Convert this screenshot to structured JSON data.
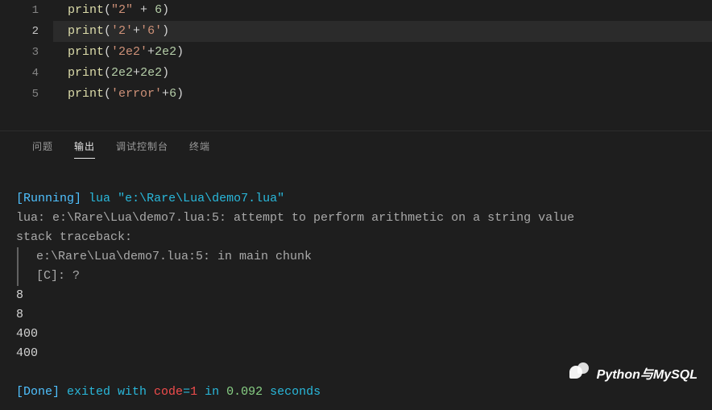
{
  "editor": {
    "active_line": 2,
    "lines": [
      {
        "num": "1",
        "tokens": [
          {
            "cls": "fn",
            "t": "print"
          },
          {
            "cls": "pun",
            "t": "("
          },
          {
            "cls": "str",
            "t": "\"2\""
          },
          {
            "cls": "pun",
            "t": " + "
          },
          {
            "cls": "num",
            "t": "6"
          },
          {
            "cls": "pun",
            "t": ")"
          }
        ]
      },
      {
        "num": "2",
        "highlight": true,
        "tokens": [
          {
            "cls": "fn",
            "t": "print"
          },
          {
            "cls": "pun",
            "t": "("
          },
          {
            "cls": "str",
            "t": "'2'"
          },
          {
            "cls": "pun",
            "t": "+"
          },
          {
            "cls": "str",
            "t": "'6'"
          },
          {
            "cls": "pun",
            "t": ")"
          }
        ]
      },
      {
        "num": "3",
        "tokens": [
          {
            "cls": "fn",
            "t": "print"
          },
          {
            "cls": "pun",
            "t": "("
          },
          {
            "cls": "str",
            "t": "'2e2'"
          },
          {
            "cls": "pun",
            "t": "+"
          },
          {
            "cls": "num",
            "t": "2e2"
          },
          {
            "cls": "pun",
            "t": ")"
          }
        ]
      },
      {
        "num": "4",
        "tokens": [
          {
            "cls": "fn",
            "t": "print"
          },
          {
            "cls": "pun",
            "t": "("
          },
          {
            "cls": "num",
            "t": "2e2"
          },
          {
            "cls": "pun",
            "t": "+"
          },
          {
            "cls": "num",
            "t": "2e2"
          },
          {
            "cls": "pun",
            "t": ")"
          }
        ]
      },
      {
        "num": "5",
        "tokens": [
          {
            "cls": "fn",
            "t": "print"
          },
          {
            "cls": "pun",
            "t": "("
          },
          {
            "cls": "str",
            "t": "'error'"
          },
          {
            "cls": "pun",
            "t": "+"
          },
          {
            "cls": "num",
            "t": "6"
          },
          {
            "cls": "pun",
            "t": ")"
          }
        ]
      }
    ]
  },
  "panel": {
    "tabs": {
      "problems": "问题",
      "output": "输出",
      "debug_console": "调试控制台",
      "terminal": "终端",
      "active": "output"
    }
  },
  "output": {
    "running_label": "[Running]",
    "running_cmd_interp": "lua",
    "running_cmd_path": "\"e:\\Rare\\Lua\\demo7.lua\"",
    "err_line1": "lua: e:\\Rare\\Lua\\demo7.lua:5: attempt to perform arithmetic on a string value",
    "err_line2": "stack traceback:",
    "err_line3": "e:\\Rare\\Lua\\demo7.lua:5: in main chunk",
    "err_line4": "[C]: ?",
    "results": [
      "8",
      "8",
      "400",
      "400"
    ],
    "done_label": "[Done]",
    "done_text1": " exited with ",
    "done_code_label": "code",
    "done_eq": "=",
    "done_code_val": "1",
    "done_text2": " in ",
    "done_time": "0.092",
    "done_text3": " seconds"
  },
  "watermark": {
    "text": "Python与MySQL"
  }
}
